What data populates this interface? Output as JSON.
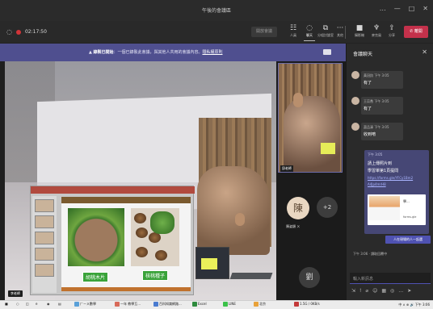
{
  "window": {
    "title": "午後的會議區",
    "controls": [
      "…",
      "—",
      "□",
      "✕"
    ]
  },
  "toolbar": {
    "timer": "02:17:50",
    "disabled_button": "開放會議",
    "items": [
      {
        "label": "人員",
        "icon": "people-icon"
      },
      {
        "label": "聊天",
        "icon": "chat-icon"
      },
      {
        "label": "分組討論室",
        "icon": "breakout-icon"
      },
      {
        "label": "其他",
        "icon": "more-icon"
      },
      {
        "label": "攝影機",
        "icon": "camera-icon"
      },
      {
        "label": "麥克風",
        "icon": "mic-icon"
      },
      {
        "label": "分享",
        "icon": "share-icon"
      }
    ],
    "leave_label": "離開"
  },
  "banner": {
    "bold": "錄製已開始",
    "text": "：一個已錄製此會議，與其他人共用的會議內容。",
    "link": "隱私權原則"
  },
  "stage": {
    "presenter_label": "李老師",
    "slide": {
      "label_left": "胡桃木片",
      "label_right": "核桃種子"
    }
  },
  "gallery": {
    "cam_label": "邱老師",
    "avatar_a": {
      "initial": "陳",
      "name": "陳姿穎 ㄨ"
    },
    "avatar_b": "+2",
    "avatar_c": "劉"
  },
  "chat": {
    "title": "會議聊天",
    "messages": [
      {
        "who": "黃冠鈞  下午 3:05",
        "text": "有了"
      },
      {
        "who": "王苡喬  下午 3:05",
        "text": "有了"
      },
      {
        "who": "蕭品溱  下午 3:05",
        "text": "收到唷"
      }
    ],
    "mine": {
      "time": "下午 3:05",
      "lines": [
        "請上傳照片到",
        "學習單第1頁提問"
      ],
      "link1": "https://forms.gle/YFCy1Bm2",
      "link2": "A4Jp4mrH8",
      "card_title": "學...",
      "card_src": "forms.gle"
    },
    "reply_button": "人在現場的人一起選",
    "typing": "下午 3:06 · 讀取回覆中",
    "input_placeholder": "輸入新訊息",
    "format_icons": [
      "⇲",
      "!",
      "⌀",
      "☺",
      "▦",
      "◎",
      "…",
      "➤"
    ]
  },
  "taskbar": {
    "items": [
      "ㄏㄧㄨ數學",
      "一年 教學互...",
      "百科知識網路...",
      "Excel",
      "LINE",
      "北京",
      "1.5G / 0KB/s"
    ],
    "tray": "中 ∧ ⊕ 🔊 下午 3:06"
  },
  "colors": {
    "accent": "#4f52b2",
    "leave": "#c4314b",
    "banner": "#4f4f8f",
    "chat_bg": "#2a2a2a"
  }
}
